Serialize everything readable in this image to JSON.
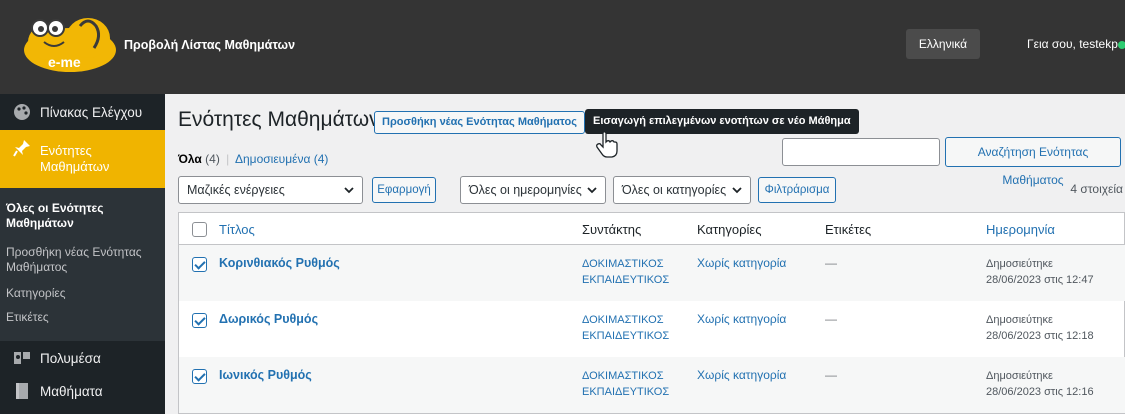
{
  "header": {
    "logo_text": "e-me",
    "site_title": "Προβολή Λίστας Μαθημάτων",
    "language": "Ελληνικά",
    "greeting": "Γεια σου, testekp"
  },
  "sidebar": {
    "items": [
      {
        "label": "Πίνακας Ελέγχου",
        "icon": "palette-icon"
      },
      {
        "label": "Ενότητες Μαθημάτων",
        "icon": "pin-icon"
      },
      {
        "label": "Πολυμέσα",
        "icon": "media-icon"
      },
      {
        "label": "Μαθήματα",
        "icon": "book-icon"
      }
    ],
    "submenu": [
      "Όλες οι Ενότητες Μαθημάτων",
      "Προσθήκη νέας Ενότητας Μαθήματος",
      "Κατηγορίες",
      "Ετικέτες"
    ]
  },
  "page": {
    "title": "Ενότητες Μαθημάτων",
    "add_new_label": "Προσθήκη νέας Ενότητας Μαθήματος",
    "import_label": "Εισαγωγή επιλεγμένων ενοτήτων σε νέο Μάθημα",
    "filters": {
      "all_label": "Όλα",
      "all_count": "(4)",
      "separator": "|",
      "published_label": "Δημοσιευμένα (4)"
    },
    "search": {
      "value": "",
      "button_label": "Αναζήτηση Ενότητας Μαθήματος"
    },
    "bulk_actions": "Μαζικές ενέργειες",
    "apply_label": "Εφαρμογή",
    "dates_filter": "Όλες οι ημερομηνίες",
    "categories_filter": "Όλες οι κατηγορίες",
    "filter_button": "Φιλτράρισμα",
    "items_count": "4 στοιχεία"
  },
  "table": {
    "columns": [
      "Τίτλος",
      "Συντάκτης",
      "Κατηγορίες",
      "Ετικέτες",
      "Ημερομηνία"
    ],
    "rows": [
      {
        "title": "Κορινθιακός Ρυθμός",
        "author_line1": "ΔΟΚΙΜΑΣΤΙΚΟΣ",
        "author_line2": "ΕΚΠΑΙΔΕΥΤΙΚΟΣ",
        "category": "Χωρίς κατηγορία",
        "tags": "—",
        "status": "Δημοσιεύτηκε",
        "date": "28/06/2023 στις 12:47",
        "checked": true
      },
      {
        "title": "Δωρικός Ρυθμός",
        "author_line1": "ΔΟΚΙΜΑΣΤΙΚΟΣ",
        "author_line2": "ΕΚΠΑΙΔΕΥΤΙΚΟΣ",
        "category": "Χωρίς κατηγορία",
        "tags": "—",
        "status": "Δημοσιεύτηκε",
        "date": "28/06/2023 στις 12:18",
        "checked": true
      },
      {
        "title": "Ιωνικός Ρυθμός",
        "author_line1": "ΔΟΚΙΜΑΣΤΙΚΟΣ",
        "author_line2": "ΕΚΠΑΙΔΕΥΤΙΚΟΣ",
        "category": "Χωρίς κατηγορία",
        "tags": "—",
        "status": "Δημοσιεύτηκε",
        "date": "28/06/2023 στις 12:16",
        "checked": true
      }
    ]
  },
  "colors": {
    "topbar": "#343434",
    "sidebar": "#1d2327",
    "active_menu": "#f0b400",
    "link": "#2271b1"
  }
}
